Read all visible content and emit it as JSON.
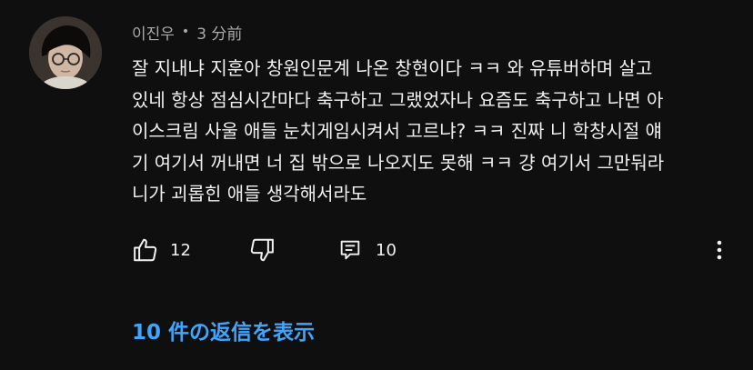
{
  "comment": {
    "author": "이진우",
    "separator": "•",
    "time": "3 分前",
    "text_lines": [
      "잘 지내냐 지훈아 창원인문계 나온 창현이다 ㅋㅋ 와 유튜버하며 살고",
      "있네 항상 점심시간마다 축구하고 그랬었자나 요즘도 축구하고 나면 아",
      "이스크림 사울 애들 눈치게임시켜서 고르냐? ㅋㅋ 진짜 니 학창시절 얘",
      "기 여기서 꺼내면 너 집 밖으로 나오지도 못해 ㅋㅋ 걍 여기서 그만둬라",
      "니가 괴롭힌 애들 생각해서라도"
    ]
  },
  "actions": {
    "like_count": "12",
    "reply_count": "10"
  },
  "replies": {
    "show_label": "10 件の返信を表示"
  },
  "icons": {
    "like": "thumbs-up-icon",
    "dislike": "thumbs-down-icon",
    "reply": "comment-icon",
    "more": "more-vertical-icon"
  },
  "colors": {
    "background": "#0f0f0f",
    "text": "#f1f1f1",
    "secondary_text": "#aaaaaa",
    "link": "#3ea6ff"
  }
}
